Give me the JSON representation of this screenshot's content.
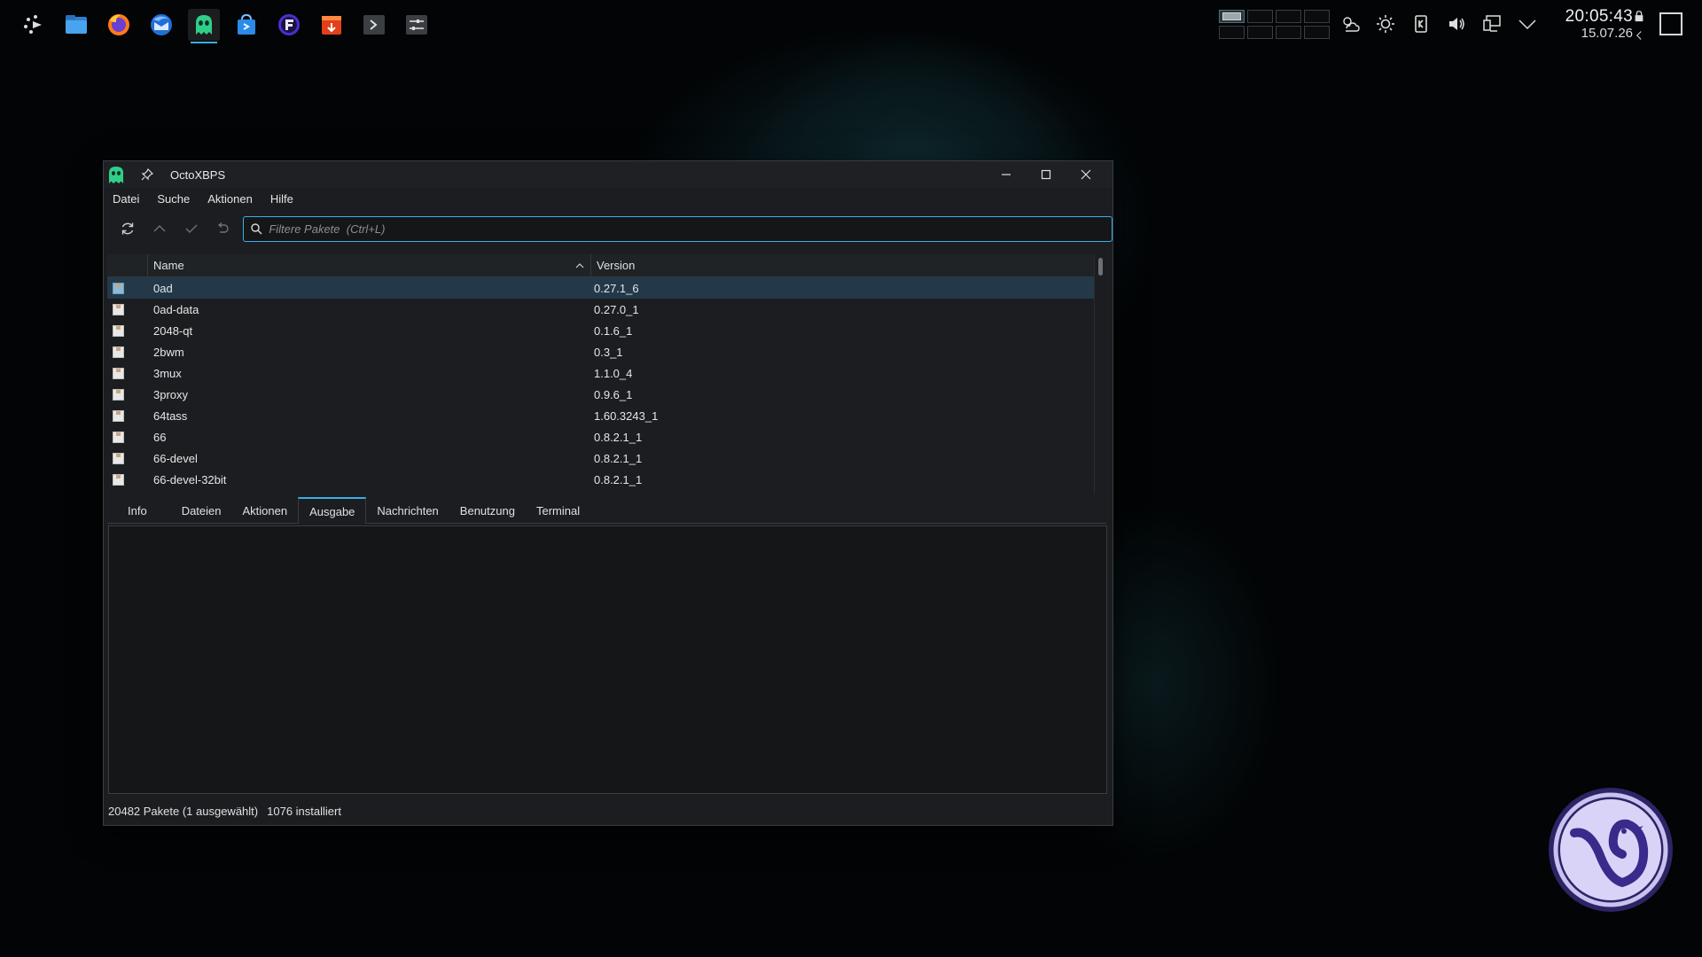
{
  "panel": {
    "launchers": [
      {
        "name": "application-launcher",
        "icon": "arrows-launcher-icon"
      },
      {
        "name": "file-manager",
        "icon": "folder-icon"
      },
      {
        "name": "firefox",
        "icon": "firefox-icon"
      },
      {
        "name": "thunderbird",
        "icon": "thunderbird-icon"
      },
      {
        "name": "octoxbps",
        "icon": "ghost-icon",
        "active": true
      },
      {
        "name": "software-store",
        "icon": "store-bag-icon"
      },
      {
        "name": "app-f",
        "icon": "f-circle-icon"
      },
      {
        "name": "media-app",
        "icon": "film-icon"
      },
      {
        "name": "terminal",
        "icon": "terminal-icon"
      },
      {
        "name": "settings",
        "icon": "sliders-icon"
      }
    ],
    "clock": {
      "time": "20:05:43",
      "date": "15.07.26"
    },
    "accent": "#3daee9"
  },
  "window": {
    "title": "OctoXBPS",
    "menu": [
      "Datei",
      "Suche",
      "Aktionen",
      "Hilfe"
    ],
    "search": {
      "placeholder": "Filtere Pakete  (Ctrl+L)",
      "value": ""
    },
    "table": {
      "columns": {
        "name": "Name",
        "version": "Version"
      },
      "rows": [
        {
          "name": "0ad",
          "version": "0.27.1_6",
          "selected": true
        },
        {
          "name": "0ad-data",
          "version": "0.27.0_1"
        },
        {
          "name": "2048-qt",
          "version": "0.1.6_1"
        },
        {
          "name": "2bwm",
          "version": "0.3_1"
        },
        {
          "name": "3mux",
          "version": "1.1.0_4"
        },
        {
          "name": "3proxy",
          "version": "0.9.6_1"
        },
        {
          "name": "64tass",
          "version": "1.60.3243_1"
        },
        {
          "name": "66",
          "version": "0.8.2.1_1"
        },
        {
          "name": "66-devel",
          "version": "0.8.2.1_1"
        },
        {
          "name": "66-devel-32bit",
          "version": "0.8.2.1_1"
        }
      ]
    },
    "tabs": [
      "Info",
      "Dateien",
      "Aktionen",
      "Ausgabe",
      "Nachrichten",
      "Benutzung",
      "Terminal"
    ],
    "active_tab": "Ausgabe",
    "status": {
      "packages": "20482 Pakete (1 ausgewählt)",
      "installed": "1076 installiert"
    }
  }
}
